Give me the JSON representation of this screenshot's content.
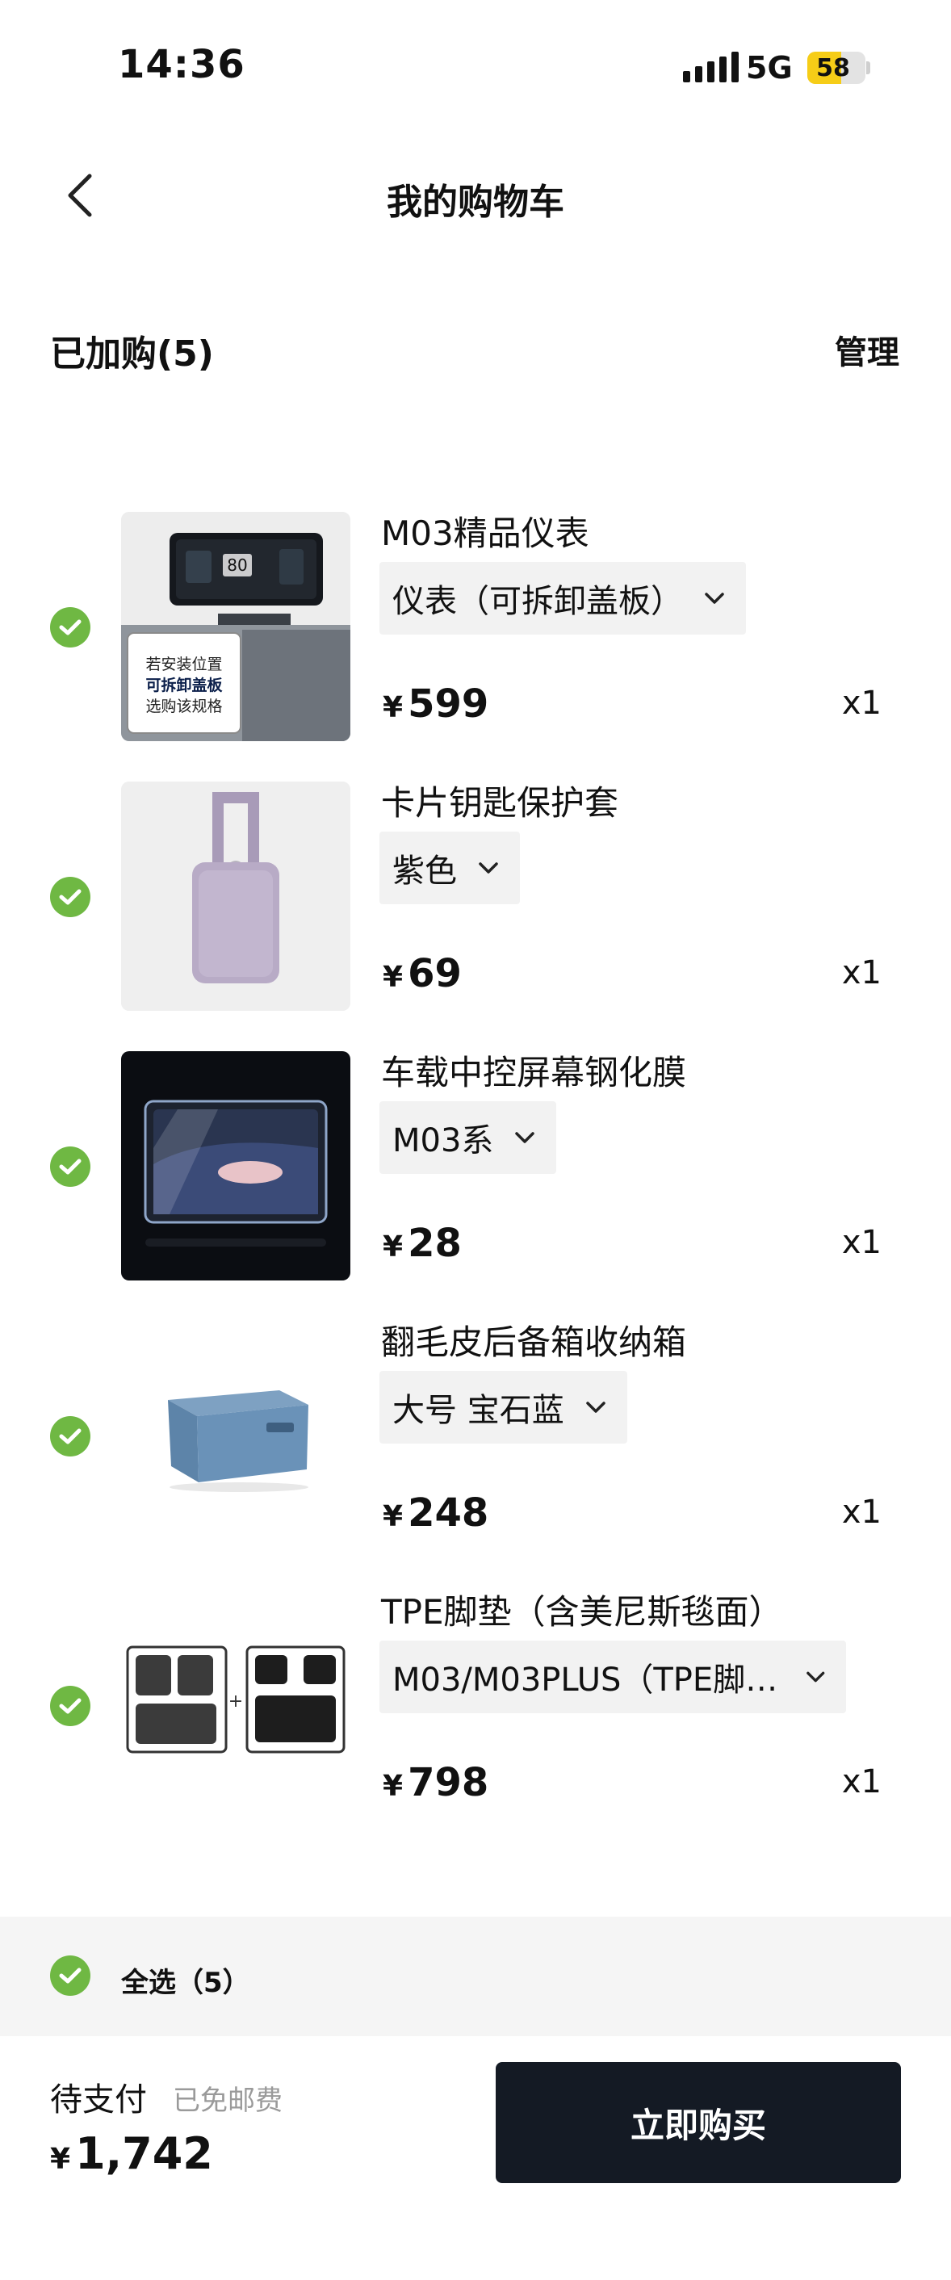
{
  "status_bar": {
    "time": "14:36",
    "network": "5G",
    "battery": "58",
    "battery_level": 0.58
  },
  "nav": {
    "title": "我的购物车",
    "back_icon": "chevron-left-icon"
  },
  "cart": {
    "count_label": "已加购(5)",
    "manage_label": "管理"
  },
  "items": [
    {
      "name": "M03精品仪表",
      "spec": "仪表（可拆卸盖板）",
      "price": "599",
      "currency": "¥",
      "qty": "x1",
      "image_lines": [
        "若安装位置",
        "可拆卸盖板",
        "选购该规格"
      ],
      "screen_value": "80"
    },
    {
      "name": "卡片钥匙保护套",
      "spec": "紫色",
      "price": "69",
      "currency": "¥",
      "qty": "x1"
    },
    {
      "name": "车载中控屏幕钢化膜",
      "spec": "M03系",
      "price": "28",
      "currency": "¥",
      "qty": "x1"
    },
    {
      "name": "翻毛皮后备箱收纳箱",
      "spec": "大号 宝石蓝",
      "price": "248",
      "currency": "¥",
      "qty": "x1"
    },
    {
      "name": "TPE脚垫（含美尼斯毯面）",
      "spec": "M03/M03PLUS（TPE脚垫...",
      "price": "798",
      "currency": "¥",
      "qty": "x1"
    }
  ],
  "select_all": {
    "label": "全选（5）"
  },
  "footer": {
    "pay_label": "待支付",
    "shipping_note": "已免邮费",
    "currency": "¥",
    "total": "1,742",
    "buy_label": "立即购买"
  },
  "colors": {
    "check_green": "#6fb843",
    "buy_button": "#141a24",
    "spec_bg": "#f2f2f2",
    "battery_yellow": "#f6cd17"
  }
}
